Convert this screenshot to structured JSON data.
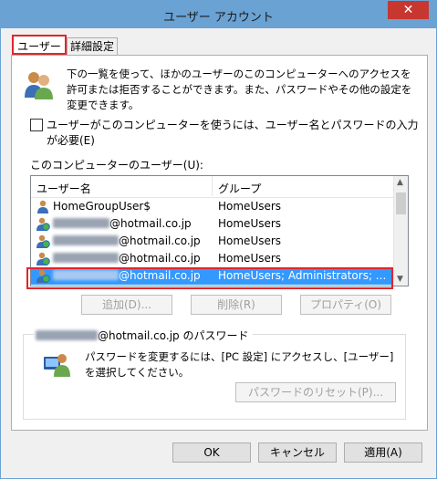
{
  "window": {
    "title": "ユーザー アカウント",
    "close": "✕"
  },
  "tabs": [
    {
      "label": "ユーザー"
    },
    {
      "label": "詳細設定"
    }
  ],
  "description": "下の一覧を使って、ほかのユーザーのこのコンピューターへのアクセスを許可または拒否することができます。また、パスワードやその他の設定を変更できます。",
  "require_login_checkbox": {
    "label": "ユーザーがこのコンピューターを使うには、ユーザー名とパスワードの入力が必要(E)",
    "checked": false
  },
  "users_label": "このコンピューターのユーザー(U):",
  "users_table": {
    "columns": [
      "ユーザー名",
      "グループ"
    ],
    "rows": [
      {
        "name": "HomeGroupUser$",
        "group": "HomeUsers",
        "selected": false,
        "icon": "user-icon"
      },
      {
        "name": "@hotmail.co.jp",
        "group": "HomeUsers",
        "selected": false,
        "icon": "user-globe-icon"
      },
      {
        "name": "@hotmail.co.jp",
        "group": "HomeUsers",
        "selected": false,
        "icon": "user-globe-icon"
      },
      {
        "name": "@hotmail.co.jp",
        "group": "HomeUsers",
        "selected": false,
        "icon": "user-globe-icon"
      },
      {
        "name": "@hotmail.co.jp",
        "group": "HomeUsers; Administrators; ...",
        "selected": true,
        "icon": "user-globe-icon"
      }
    ]
  },
  "buttons": {
    "add": "追加(D)...",
    "remove": "削除(R)",
    "properties": "プロパティ(O)"
  },
  "password_group": {
    "title": "@hotmail.co.jp のパスワード",
    "text": "パスワードを変更するには、[PC 設定] にアクセスし、[ユーザー] を選択してください。",
    "reset_button": "パスワードのリセット(P)..."
  },
  "footer": {
    "ok": "OK",
    "cancel": "キャンセル",
    "apply": "適用(A)"
  },
  "colors": {
    "titlebar": "#6aa2d3",
    "close": "#c7372f",
    "selection": "#3399ff",
    "highlight": "#e0252b"
  }
}
